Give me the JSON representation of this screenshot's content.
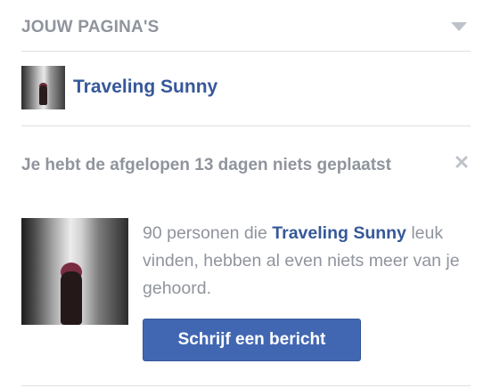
{
  "header": {
    "title": "JOUW PAGINA'S",
    "menu_icon": "chevron-down-icon"
  },
  "page": {
    "name": "Traveling Sunny",
    "thumbnail": "page-thumbnail"
  },
  "notice": {
    "title": "Je hebt de afgelopen 13 dagen niets geplaatst",
    "close_icon": "close-icon",
    "text_before": "90 personen die ",
    "page_link": "Traveling Sunny",
    "text_after": " leuk vinden, hebben al even niets meer van je gehoord.",
    "button_label": "Schrijf een bericht"
  },
  "colors": {
    "link": "#365899",
    "muted": "#90949c",
    "button": "#4267b2"
  }
}
